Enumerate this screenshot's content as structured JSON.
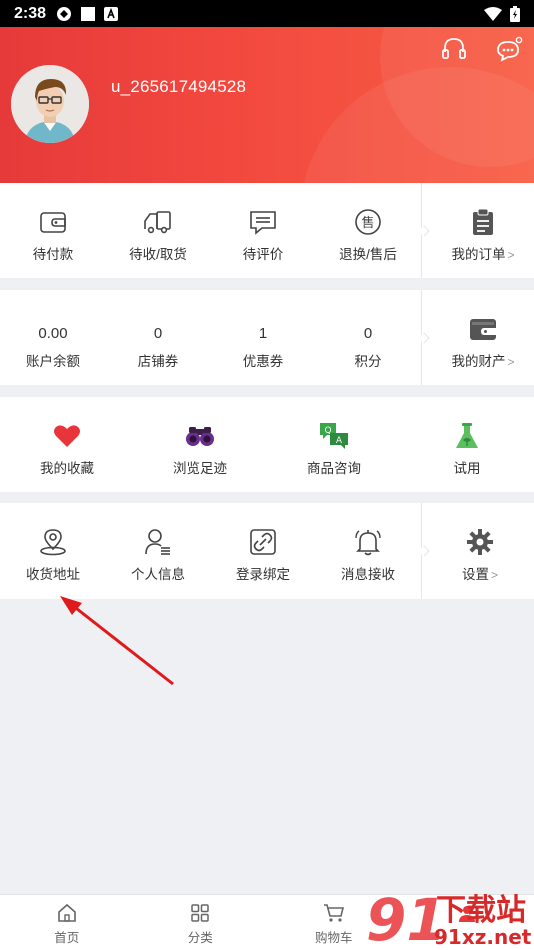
{
  "status_bar": {
    "time": "2:38"
  },
  "header": {
    "username": "u_265617494528",
    "icons": [
      "headset-icon",
      "chat-bubble-icon"
    ]
  },
  "orders": {
    "items": [
      {
        "label": "待付款",
        "icon": "wallet-icon"
      },
      {
        "label": "待收/取货",
        "icon": "truck-icon"
      },
      {
        "label": "待评价",
        "icon": "comment-icon"
      },
      {
        "label": "退换/售后",
        "icon": "after-sale-icon"
      }
    ],
    "all": {
      "label": "我的订单",
      "chevron": ">"
    }
  },
  "assets": {
    "items": [
      {
        "value": "0.00",
        "label": "账户余额"
      },
      {
        "value": "0",
        "label": "店铺券"
      },
      {
        "value": "1",
        "label": "优惠券"
      },
      {
        "value": "0",
        "label": "积分"
      }
    ],
    "all": {
      "label": "我的财产",
      "chevron": ">"
    }
  },
  "features": {
    "items": [
      {
        "label": "我的收藏",
        "icon": "heart-icon",
        "color": "#e8353a"
      },
      {
        "label": "浏览足迹",
        "icon": "binoculars-icon",
        "color": "#6b2d8c"
      },
      {
        "label": "商品咨询",
        "icon": "qa-icon",
        "color": "#3aa64a"
      },
      {
        "label": "试用",
        "icon": "flask-icon",
        "color": "#3aa64a"
      }
    ]
  },
  "settings_row": {
    "items": [
      {
        "label": "收货地址",
        "icon": "location-pin-icon"
      },
      {
        "label": "个人信息",
        "icon": "user-info-icon"
      },
      {
        "label": "登录绑定",
        "icon": "link-icon"
      },
      {
        "label": "消息接收",
        "icon": "bell-icon"
      }
    ],
    "all": {
      "label": "设置",
      "chevron": ">"
    }
  },
  "tabbar": {
    "items": [
      {
        "label": "首页",
        "icon": "home-icon"
      },
      {
        "label": "分类",
        "icon": "grid-icon"
      },
      {
        "label": "购物车",
        "icon": "cart-icon"
      },
      {
        "label": "",
        "icon": "user-icon"
      }
    ]
  },
  "watermark": {
    "text_top": "下载站",
    "text_bottom": "91xz.net"
  },
  "colors": {
    "accent": "#f04a3e",
    "annotation_arrow": "#e0191b"
  }
}
